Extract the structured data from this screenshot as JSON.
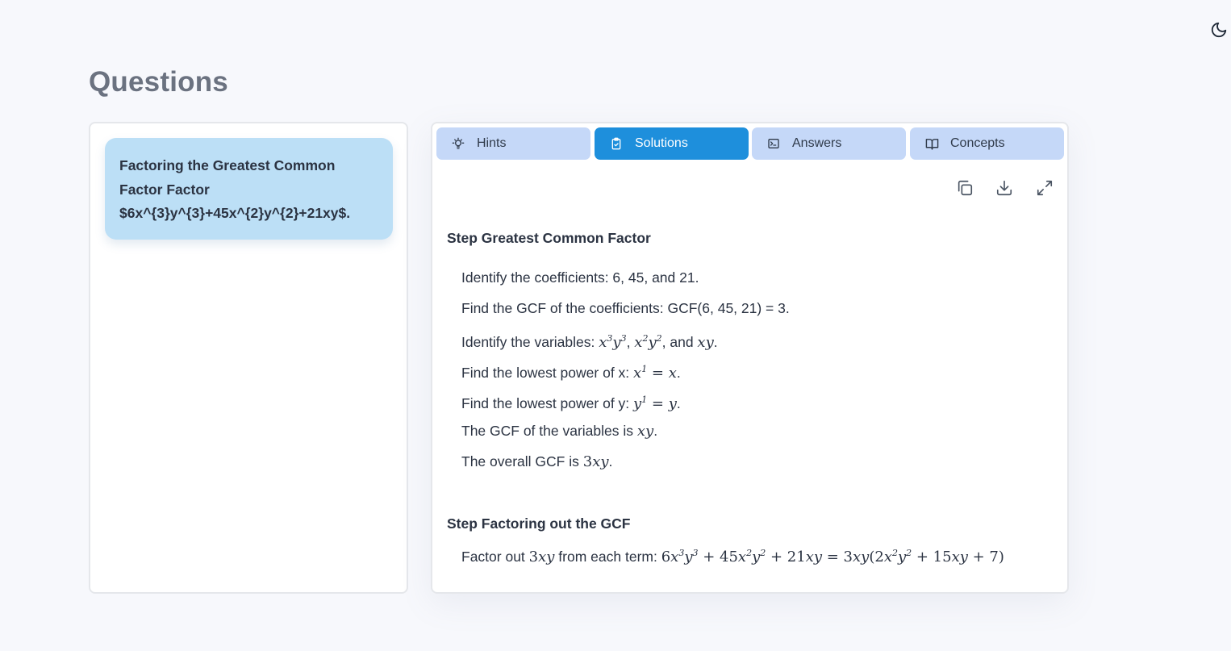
{
  "page_title": "Questions",
  "questions": [
    {
      "text": "Factoring the Greatest Common Factor Factor $6x^{3}y^{3}+45x^{2}y^{2}+21xy$."
    }
  ],
  "tabs": [
    {
      "label": "Hints",
      "icon": "lightbulb-icon"
    },
    {
      "label": "Solutions",
      "icon": "clipboard-check-icon"
    },
    {
      "label": "Answers",
      "icon": "terminal-icon"
    },
    {
      "label": "Concepts",
      "icon": "book-open-icon"
    }
  ],
  "active_tab": "Solutions",
  "toolbar": {
    "copy": "copy-icon",
    "download": "download-icon",
    "expand": "expand-icon"
  },
  "solution": {
    "step1": {
      "title": "Step Greatest Common Factor",
      "l1": "Identify the coefficients: 6, 45, and 21.",
      "l2": "Find the GCF of the coefficients: GCF(6, 45, 21) = 3.",
      "l3_prefix": "Identify the variables: ",
      "l4_prefix": "Find the lowest power of x: ",
      "l5_prefix": "Find the lowest power of y: ",
      "l6_prefix": "The GCF of the variables is ",
      "l7_prefix": "The overall GCF is "
    },
    "step2": {
      "title": "Step Factoring out the GCF",
      "l1_prefix": "Factor out ",
      "l1_mid": " from each term: "
    }
  },
  "colors": {
    "accent": "#1e8fdc",
    "tab_bg": "#c5d8f8",
    "card_bg": "#bcdff6"
  }
}
